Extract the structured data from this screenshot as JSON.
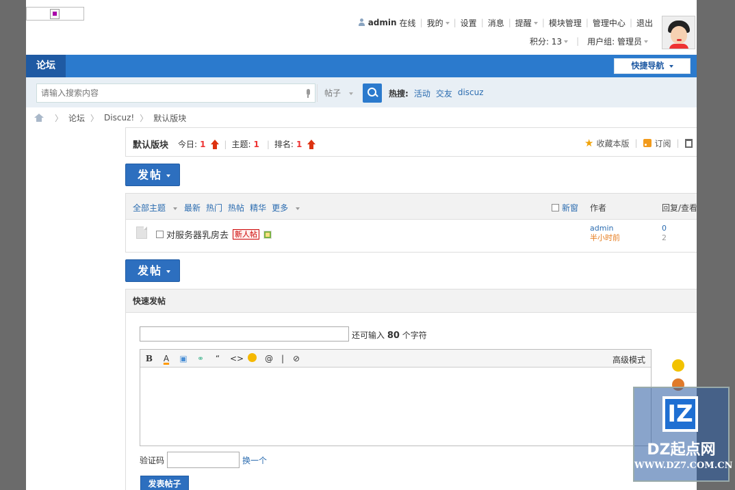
{
  "topbar": {
    "username": "admin",
    "online": "在线",
    "my": "我的",
    "settings": "设置",
    "messages": "消息",
    "reminders": "提醒",
    "block_manage": "模块管理",
    "admin_center": "管理中心",
    "logout": "退出",
    "points": "积分: 13",
    "usergroup": "用户组: 管理员"
  },
  "nav": {
    "forum": "论坛",
    "quick_nav": "快捷导航"
  },
  "search": {
    "placeholder": "请输入搜索内容",
    "type": "帖子",
    "hot_label": "热搜:",
    "hot_items": [
      "活动",
      "交友",
      "discuz"
    ]
  },
  "breadcrumb": {
    "items": [
      "论坛",
      "Discuz!",
      "默认版块"
    ]
  },
  "forum": {
    "name": "默认版块",
    "today_label": "今日:",
    "today": "1",
    "threads_label": "主题:",
    "threads": "1",
    "rank_label": "排名:",
    "rank": "1",
    "favorite": "收藏本版",
    "subscribe": "订阅"
  },
  "post_button": "发帖",
  "thread_list": {
    "filters": [
      "全部主题",
      "最新",
      "热门",
      "热帖",
      "精华",
      "更多"
    ],
    "new_window": "新窗",
    "author_col": "作者",
    "reply_col": "回复/查看",
    "rows": [
      {
        "title": "对服务器乳房去",
        "badge": "新人帖",
        "author": "admin",
        "time": "半小时前",
        "replies": "0",
        "views": "2"
      }
    ]
  },
  "quick_post": {
    "title": "快速发帖",
    "remain_prefix": "还可输入",
    "remain_count": "80",
    "remain_suffix": "个字符",
    "advanced": "高级模式",
    "captcha_label": "验证码",
    "captcha_change": "换一个",
    "submit": "发表帖子"
  },
  "watermark": {
    "logo": "IZ",
    "name": "DZ起点网",
    "url": "WWW.DZ7.COM.CN"
  },
  "colors": {
    "nav_bg": "#2b7acd",
    "nav_active": "#1f5aa3",
    "link": "#2b6cb0",
    "accent_red": "#e33"
  }
}
